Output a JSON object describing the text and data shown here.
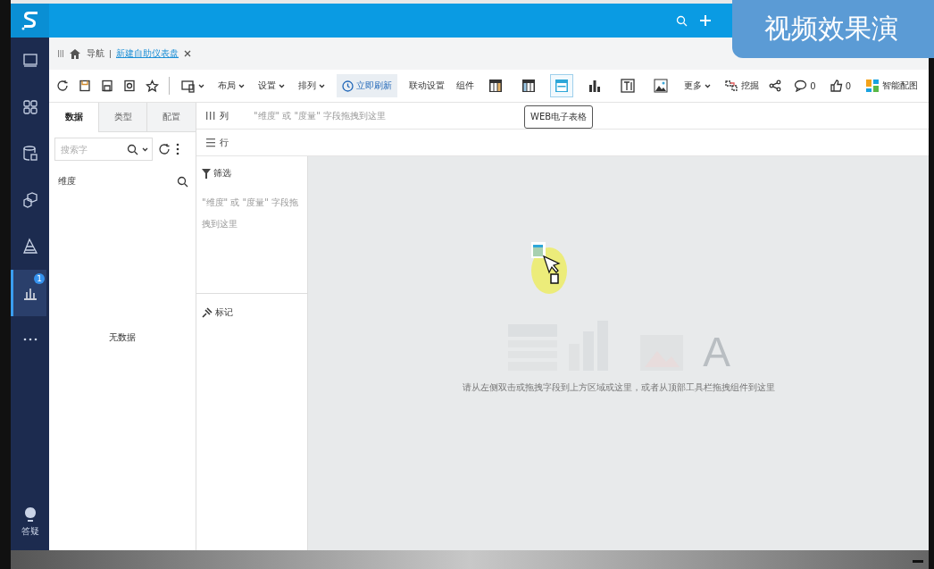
{
  "overlay_label": "视频效果演",
  "nav": {
    "items": [
      {
        "kind": "monitor",
        "selected": false
      },
      {
        "kind": "grid",
        "selected": false
      },
      {
        "kind": "database",
        "selected": false
      },
      {
        "kind": "cubes",
        "selected": false
      },
      {
        "kind": "pyramid",
        "selected": false
      },
      {
        "kind": "chart",
        "selected": true,
        "badge": "1"
      },
      {
        "kind": "more",
        "selected": false
      }
    ],
    "help": "答疑"
  },
  "breadcrumb": {
    "home": "导航",
    "current": "新建自助仪表盘"
  },
  "toolbar": {
    "items": [
      {
        "kind": "refresh"
      },
      {
        "kind": "save"
      },
      {
        "kind": "save-as"
      },
      {
        "kind": "preview"
      },
      {
        "kind": "star"
      },
      {
        "kind": "divider"
      },
      {
        "kind": "device"
      },
      {
        "kind": "dropdown",
        "label": "布局"
      },
      {
        "kind": "dropdown",
        "label": "设置"
      },
      {
        "kind": "dropdown",
        "label": "排列"
      },
      {
        "kind": "primary",
        "label": "立即刷新"
      },
      {
        "kind": "text",
        "label": "联动设置"
      },
      {
        "kind": "label",
        "label": "组件"
      },
      {
        "kind": "widget-table",
        "selected": false
      },
      {
        "kind": "widget-crosstable",
        "selected": false
      },
      {
        "kind": "widget-webtable",
        "selected": true,
        "tooltip": "WEB电子表格"
      },
      {
        "kind": "widget-bar",
        "selected": false
      },
      {
        "kind": "widget-text",
        "selected": false
      },
      {
        "kind": "widget-image",
        "selected": false
      },
      {
        "kind": "dropdown",
        "label": "更多"
      },
      {
        "kind": "drill",
        "label": "挖掘"
      }
    ],
    "right": [
      {
        "kind": "share"
      },
      {
        "kind": "comment",
        "count": "0"
      },
      {
        "kind": "like",
        "count": "0"
      },
      {
        "kind": "smart",
        "label": "智能配图"
      }
    ]
  },
  "data_panel": {
    "tabs": [
      {
        "label": "数据",
        "selected": true
      },
      {
        "label": "类型",
        "selected": false
      },
      {
        "label": "配置",
        "selected": false
      }
    ],
    "search": {
      "placeholder": "搜索字"
    },
    "header": "维度",
    "empty": "无数据"
  },
  "shelf": {
    "columns": {
      "label": "列",
      "hint": "\"维度\" 或 \"度量\" 字段拖拽到这里"
    },
    "rows": {
      "label": "行"
    },
    "filter": {
      "label": "筛选",
      "hint": "\"维度\" 或 \"度量\" 字段拖拽到这里"
    },
    "marks": {
      "label": "标记"
    }
  },
  "canvas": {
    "glyph": "A",
    "hint": "请从左侧双击或拖拽字段到上方区域或这里，或者从顶部工具栏拖拽组件到这里"
  }
}
